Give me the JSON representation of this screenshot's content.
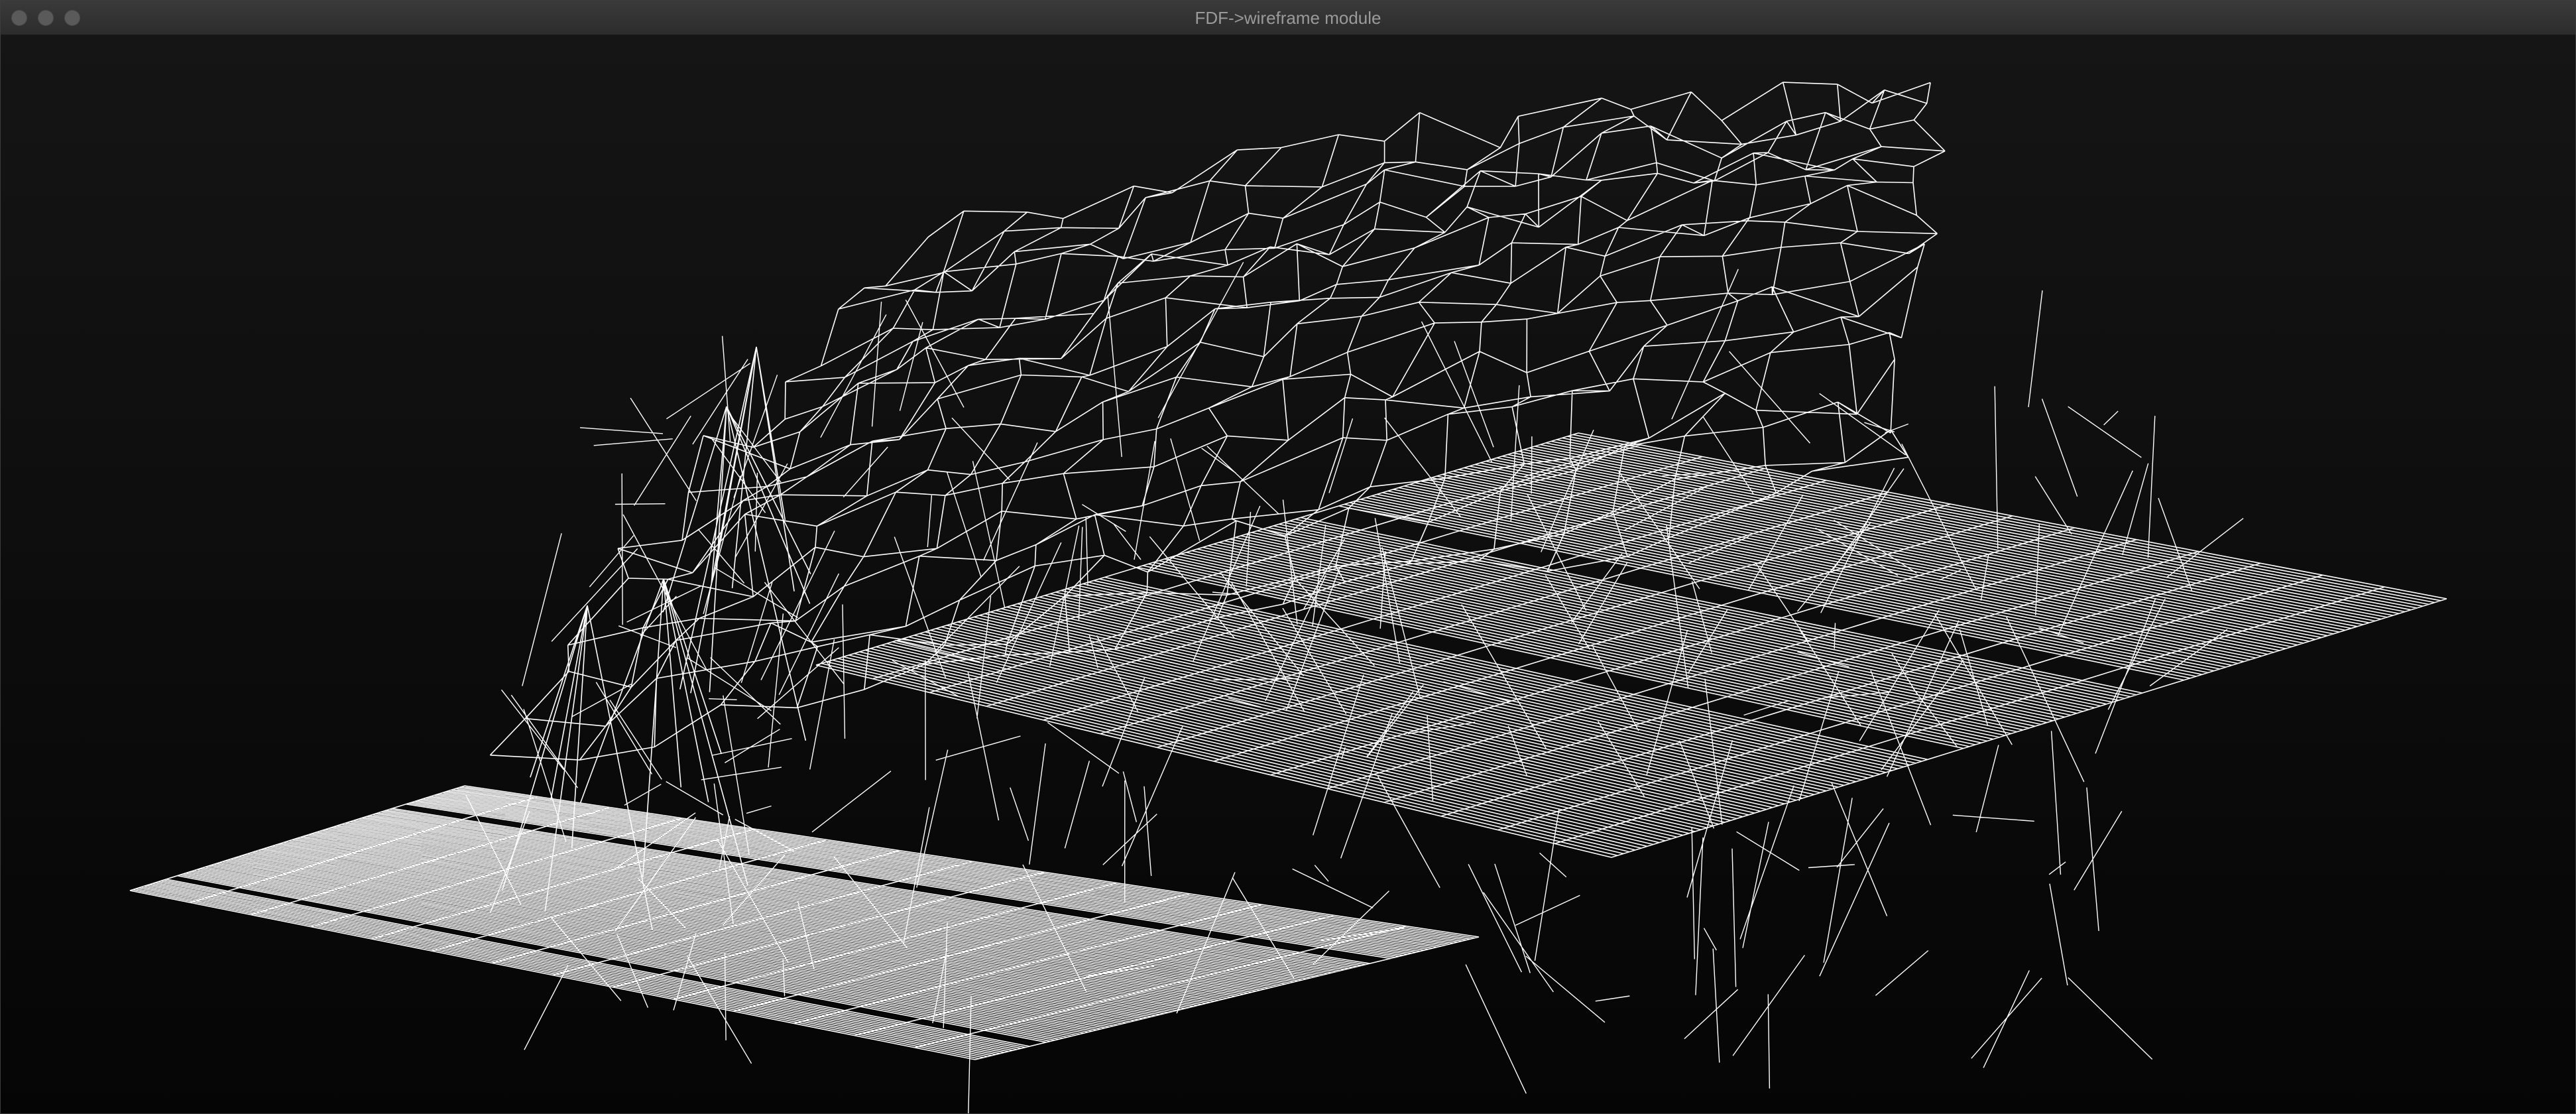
{
  "window": {
    "title": "FDF->wireframe module"
  },
  "titlebar_buttons": [
    {
      "name": "close",
      "icon": "traffic-light-close-icon"
    },
    {
      "name": "minimize",
      "icon": "traffic-light-minimize-icon"
    },
    {
      "name": "zoom",
      "icon": "traffic-light-zoom-icon"
    }
  ],
  "colors": {
    "background": "#0b0b0b",
    "wire": "#ffffff",
    "titlebar": "#333333",
    "title_text": "#9a9a9a"
  }
}
